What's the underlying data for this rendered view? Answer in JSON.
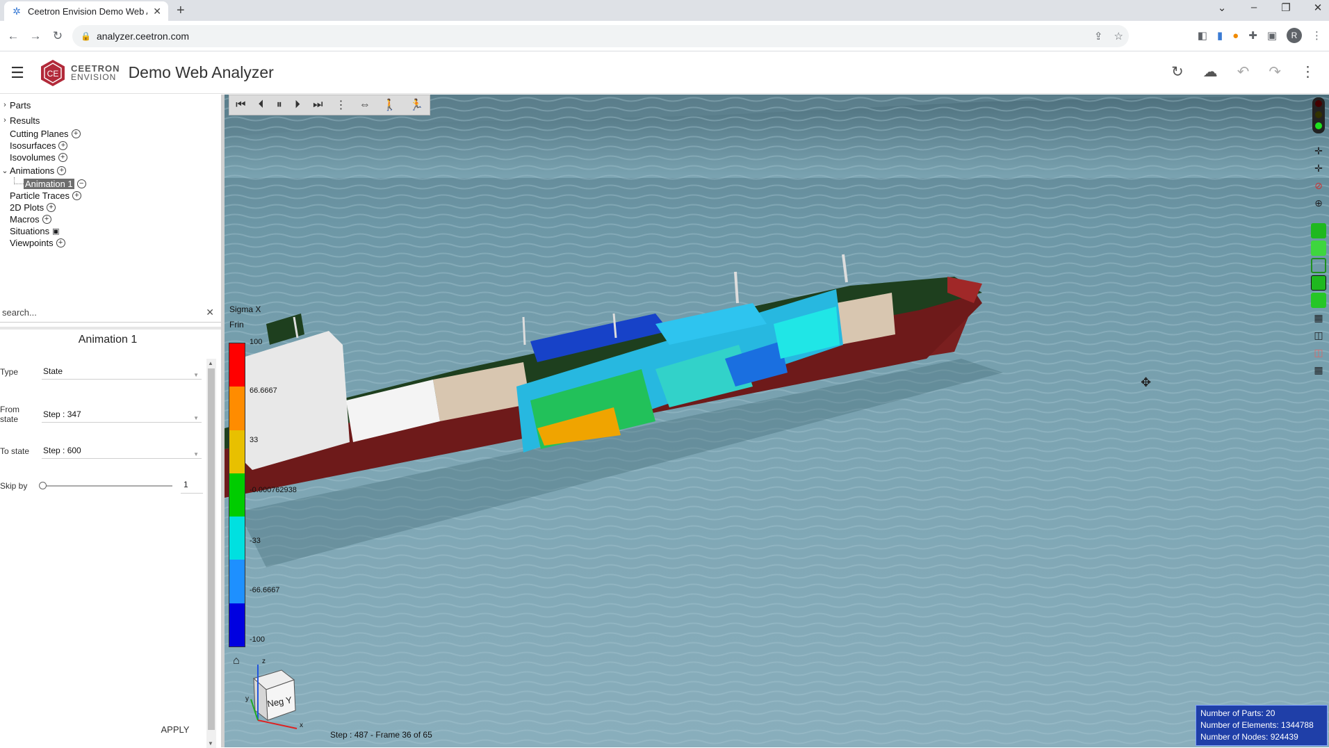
{
  "browser": {
    "tab_title": "Ceetron Envision Demo Web An",
    "url": "analyzer.ceetron.com",
    "profile_initial": "R"
  },
  "app": {
    "brand_line1": "CEETRON",
    "brand_line2": "ENVISION",
    "logo_text": "CE",
    "title": "Demo Web Analyzer"
  },
  "tree": {
    "items": [
      {
        "label": "Parts",
        "plus": false
      },
      {
        "label": "Results",
        "plus": false
      },
      {
        "label": "Cutting Planes",
        "plus": true
      },
      {
        "label": "Isosurfaces",
        "plus": true
      },
      {
        "label": "Isovolumes",
        "plus": true
      },
      {
        "label": "Animations",
        "plus": true
      },
      {
        "label": "Animation 1",
        "minus": true
      },
      {
        "label": "Particle Traces",
        "plus": true
      },
      {
        "label": "2D Plots",
        "plus": true
      },
      {
        "label": "Macros",
        "plus": true
      },
      {
        "label": "Situations",
        "save": true
      },
      {
        "label": "Viewpoints",
        "plus": true
      }
    ]
  },
  "search": {
    "placeholder": "search..."
  },
  "animation_panel": {
    "title": "Animation 1",
    "type_label": "Type",
    "type_value": "State",
    "from_label": "From state",
    "from_value": "Step : 347",
    "to_label": "To state",
    "to_value": "Step : 600",
    "skip_label": "Skip by",
    "skip_value": "1",
    "skip_slider_fraction": 0.0,
    "apply_label": "APPLY"
  },
  "legend": {
    "title": "Sigma X",
    "subtitle": "Frin",
    "ticks": [
      "100",
      "66.6667",
      "33",
      "-0.000762938",
      "-33",
      "-66.6667",
      "-100"
    ],
    "colors": [
      "#ff0000",
      "#ff8c00",
      "#e8c000",
      "#00cc00",
      "#00e0e0",
      "#1e90ff",
      "#0000e0"
    ]
  },
  "triad": {
    "label": "Neg Y",
    "axis_z": "z",
    "axis_x": "x",
    "axis_y": "y"
  },
  "frame_info": "Step : 487 - Frame 36 of 65",
  "stats": {
    "parts": "Number of Parts: 20",
    "elements": "Number of Elements: 1344788",
    "nodes": "Number of Nodes: 924439"
  },
  "colors": {
    "hull_red": "#7a1f1f",
    "deck_green": "#1e3f1e",
    "water": "#7da5b3",
    "brand": "#b22a3a"
  },
  "icons": {
    "anim_toolbar": [
      "first-frame-icon",
      "prev-frame-icon",
      "pause-icon",
      "next-frame-icon",
      "last-frame-icon",
      "more-vert-icon",
      "bounce-icon",
      "walk-icon",
      "run-icon"
    ]
  }
}
